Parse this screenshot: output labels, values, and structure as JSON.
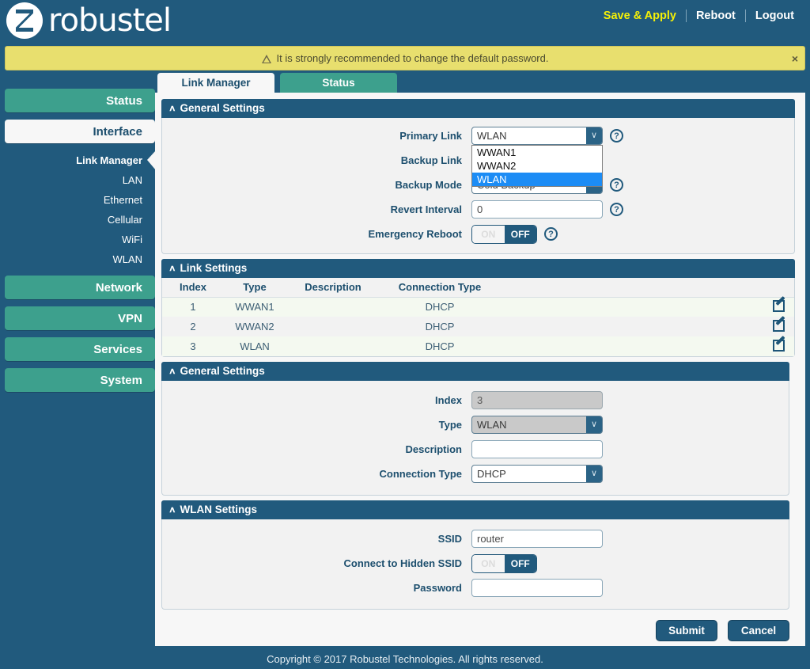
{
  "header": {
    "brand": "robustel",
    "nav": [
      {
        "label": "Save & Apply",
        "accent": true
      },
      {
        "label": "Reboot",
        "accent": false
      },
      {
        "label": "Logout",
        "accent": false
      }
    ]
  },
  "warning": {
    "text": "It is strongly recommended to change the default password.",
    "close": "×"
  },
  "sidebar": {
    "groups": [
      {
        "label": "Status",
        "active": false
      },
      {
        "label": "Interface",
        "active": true
      },
      {
        "label": "Network",
        "active": false
      },
      {
        "label": "VPN",
        "active": false
      },
      {
        "label": "Services",
        "active": false
      },
      {
        "label": "System",
        "active": false
      }
    ],
    "sub_items": [
      {
        "label": "Link Manager",
        "selected": true
      },
      {
        "label": "LAN",
        "selected": false
      },
      {
        "label": "Ethernet",
        "selected": false
      },
      {
        "label": "Cellular",
        "selected": false
      },
      {
        "label": "WiFi",
        "selected": false
      },
      {
        "label": "WLAN",
        "selected": false
      }
    ]
  },
  "tabs": [
    {
      "label": "Link Manager",
      "selected": true
    },
    {
      "label": "Status",
      "selected": false
    }
  ],
  "general_settings": {
    "title": "General Settings",
    "primary_link": {
      "label": "Primary Link",
      "value": "WLAN",
      "options": [
        "WWAN1",
        "WWAN2",
        "WLAN"
      ],
      "highlighted": "WLAN",
      "open": true
    },
    "backup_link": {
      "label": "Backup Link"
    },
    "backup_mode": {
      "label": "Backup Mode",
      "value": "Cold Backup"
    },
    "revert_interval": {
      "label": "Revert Interval",
      "value": "0"
    },
    "emergency_reboot": {
      "label": "Emergency Reboot",
      "on": "ON",
      "off": "OFF",
      "state": "OFF"
    }
  },
  "link_settings": {
    "title": "Link Settings",
    "columns": [
      "Index",
      "Type",
      "Description",
      "Connection Type",
      ""
    ],
    "rows": [
      {
        "index": "1",
        "type": "WWAN1",
        "description": "",
        "connection_type": "DHCP"
      },
      {
        "index": "2",
        "type": "WWAN2",
        "description": "",
        "connection_type": "DHCP"
      },
      {
        "index": "3",
        "type": "WLAN",
        "description": "",
        "connection_type": "DHCP"
      }
    ]
  },
  "link_general_settings": {
    "title": "General Settings",
    "index": {
      "label": "Index",
      "value": "3"
    },
    "type": {
      "label": "Type",
      "value": "WLAN"
    },
    "description": {
      "label": "Description",
      "value": ""
    },
    "connection_type": {
      "label": "Connection Type",
      "value": "DHCP"
    }
  },
  "wlan_settings": {
    "title": "WLAN Settings",
    "ssid": {
      "label": "SSID",
      "value": "router"
    },
    "hidden_ssid": {
      "label": "Connect to Hidden SSID",
      "on": "ON",
      "off": "OFF",
      "state": "OFF"
    },
    "password": {
      "label": "Password",
      "value": ""
    }
  },
  "buttons": {
    "submit": "Submit",
    "cancel": "Cancel"
  },
  "footer": {
    "text": "Copyright © 2017 Robustel Technologies. All rights reserved."
  },
  "icons": {
    "help": "?",
    "caret_up": "∧",
    "select_arrow": "∨"
  },
  "colors": {
    "brand_blue": "#215a7d",
    "teal": "#3da08d",
    "warning_yellow": "#e8df6e",
    "accent_yellow": "#f5f007",
    "dropdown_highlight": "#1c8cf5"
  }
}
